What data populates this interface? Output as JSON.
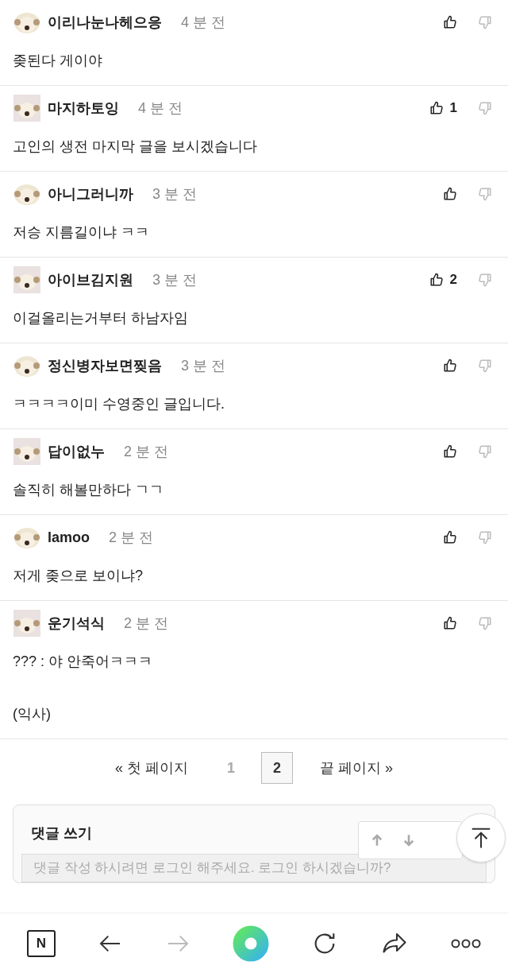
{
  "comments": [
    {
      "author": "이리나눈나헤으응",
      "time": "4 분 전",
      "body": [
        "좆된다 게이야"
      ]
    },
    {
      "author": "마지하토잉",
      "time": "4 분 전",
      "body": [
        "고인의 생전 마지막 글을 보시겠습니다"
      ],
      "likes": "1"
    },
    {
      "author": "아니그러니까",
      "time": "3 분 전",
      "body": [
        "저승 지름길이냐 ㅋㅋ"
      ]
    },
    {
      "author": "아이브김지원",
      "time": "3 분 전",
      "body": [
        "이걸올리는거부터 하남자임"
      ],
      "likes": "2"
    },
    {
      "author": "정신병자보면찢음",
      "time": "3 분 전",
      "body": [
        "ㅋㅋㅋㅋ이미 수영중인 글입니다."
      ]
    },
    {
      "author": "답이없누",
      "time": "2 분 전",
      "body": [
        "솔직히 해볼만하다 ㄱㄱ"
      ]
    },
    {
      "author": "lamoo",
      "time": "2 분 전",
      "body": [
        "저게 좆으로 보이냐?"
      ]
    },
    {
      "author": "운기석식",
      "time": "2 분 전",
      "body": [
        "??? : 야 안죽어ㅋㅋㅋ",
        "(익사)"
      ]
    }
  ],
  "pagination": {
    "first": "« 첫 페이지",
    "pages": [
      {
        "label": "1",
        "selected": false
      },
      {
        "label": "2",
        "selected": true
      }
    ],
    "last": "끝 페이지 »"
  },
  "comment_form": {
    "title": "댓글 쓰기",
    "placeholder": "댓글 작성 하시려면 로그인 해주세요. 로그인 하시겠습니까?"
  },
  "browser_bar": {
    "home_label": "N"
  }
}
